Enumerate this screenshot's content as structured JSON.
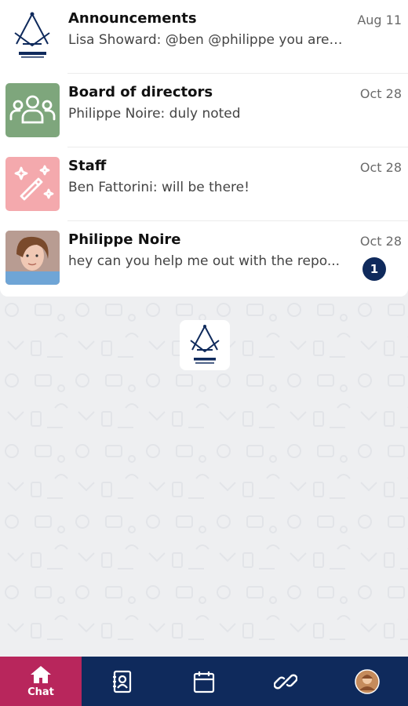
{
  "chats": [
    {
      "name": "Announcements",
      "preview": "Lisa Showard: @ben @philippe you are ...",
      "date": "Aug 11",
      "avatar": "lodge-logo",
      "unread": ""
    },
    {
      "name": "Board of directors",
      "preview": "Philippe Noire: duly noted",
      "date": "Oct 28",
      "avatar": "group-icon",
      "avatar_color": "#7ea67c",
      "unread": ""
    },
    {
      "name": "Staff",
      "preview": "Ben Fattorini: will be there!",
      "date": "Oct 28",
      "avatar": "magic-wand-icon",
      "avatar_color": "#f4a9ad",
      "unread": ""
    },
    {
      "name": "Philippe Noire",
      "preview": "hey can you help me out with the repo...",
      "date": "Oct 28",
      "avatar": "user-photo",
      "unread": "1"
    }
  ],
  "nav": {
    "chat_label": "Chat",
    "items": [
      "chat-icon",
      "contacts-icon",
      "calendar-icon",
      "link-icon",
      "profile-avatar"
    ]
  },
  "colors": {
    "nav_bg": "#0f2a5c",
    "active_tab": "#b8265c",
    "badge": "#0f2a5c"
  }
}
